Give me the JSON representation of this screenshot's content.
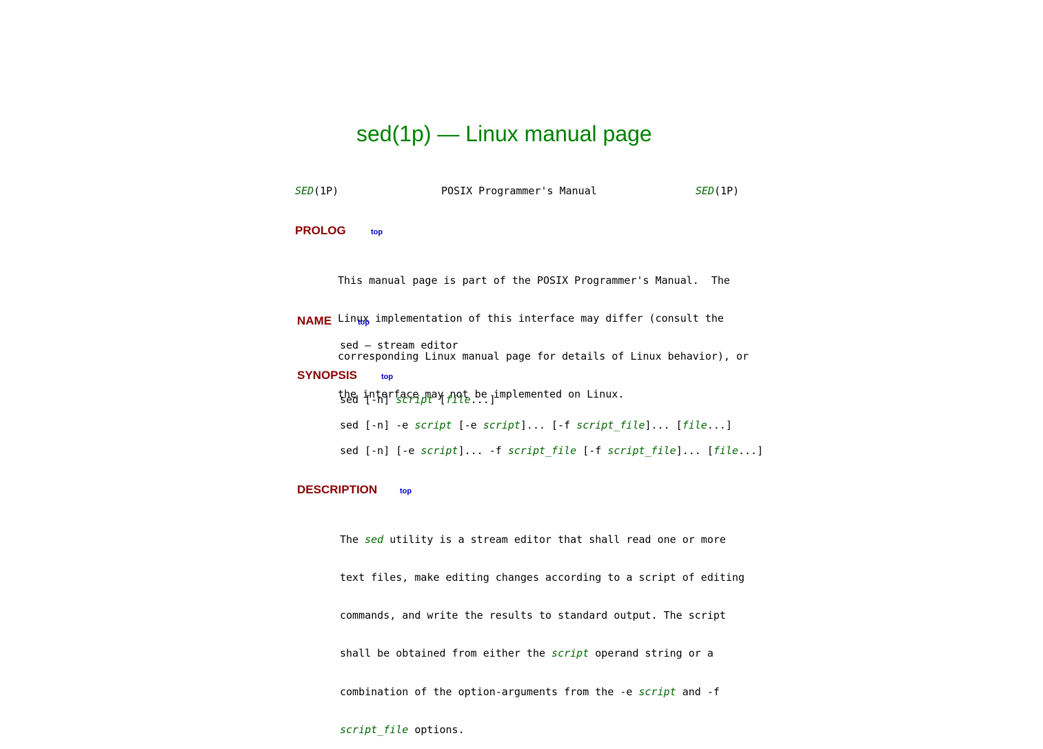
{
  "title": "sed(1p) — Linux manual page",
  "header": {
    "left_name": "SED",
    "left_section": "(1P)",
    "center": "POSIX Programmer's Manual",
    "right_name": "SED",
    "right_section": "(1P)"
  },
  "top_link_label": "top",
  "sections": {
    "prolog": {
      "heading": "PROLOG",
      "lines": [
        "This manual page is part of the POSIX Programmer's Manual.  The",
        "Linux implementation of this interface may differ (consult the",
        "corresponding Linux manual page for details of Linux behavior), or",
        "the interface may not be implemented on Linux."
      ]
    },
    "name": {
      "heading": "NAME",
      "text": "sed — stream editor"
    },
    "synopsis": {
      "heading": "SYNOPSIS",
      "lines": [
        [
          {
            "t": "sed [-n] "
          },
          {
            "t": "script",
            "em": true
          },
          {
            "t": " ["
          },
          {
            "t": "file",
            "em": true
          },
          {
            "t": "...]"
          }
        ],
        [
          {
            "t": "sed [-n] -e "
          },
          {
            "t": "script",
            "em": true
          },
          {
            "t": " [-e "
          },
          {
            "t": "script",
            "em": true
          },
          {
            "t": "]... [-f "
          },
          {
            "t": "script_file",
            "em": true
          },
          {
            "t": "]... ["
          },
          {
            "t": "file",
            "em": true
          },
          {
            "t": "...]"
          }
        ],
        [
          {
            "t": "sed [-n] [-e "
          },
          {
            "t": "script",
            "em": true
          },
          {
            "t": "]... -f "
          },
          {
            "t": "script_file",
            "em": true
          },
          {
            "t": " [-f "
          },
          {
            "t": "script_file",
            "em": true
          },
          {
            "t": "]... ["
          },
          {
            "t": "file",
            "em": true
          },
          {
            "t": "...]"
          }
        ]
      ]
    },
    "description": {
      "heading": "DESCRIPTION",
      "lines": [
        [
          {
            "t": "The "
          },
          {
            "t": "sed",
            "em": true
          },
          {
            "t": " utility is a stream editor that shall read one or more"
          }
        ],
        [
          {
            "t": "text files, make editing changes according to a script of editing"
          }
        ],
        [
          {
            "t": "commands, and write the results to standard output. The script"
          }
        ],
        [
          {
            "t": "shall be obtained from either the "
          },
          {
            "t": "script",
            "em": true
          },
          {
            "t": " operand string or a"
          }
        ],
        [
          {
            "t": "combination of the option-arguments from the "
          },
          {
            "t": "-e"
          },
          {
            "t": " "
          },
          {
            "t": "script",
            "em": true
          },
          {
            "t": " and "
          },
          {
            "t": "-f"
          }
        ],
        [
          {
            "t": "script_file",
            "em": true
          },
          {
            "t": " options."
          }
        ]
      ]
    }
  }
}
